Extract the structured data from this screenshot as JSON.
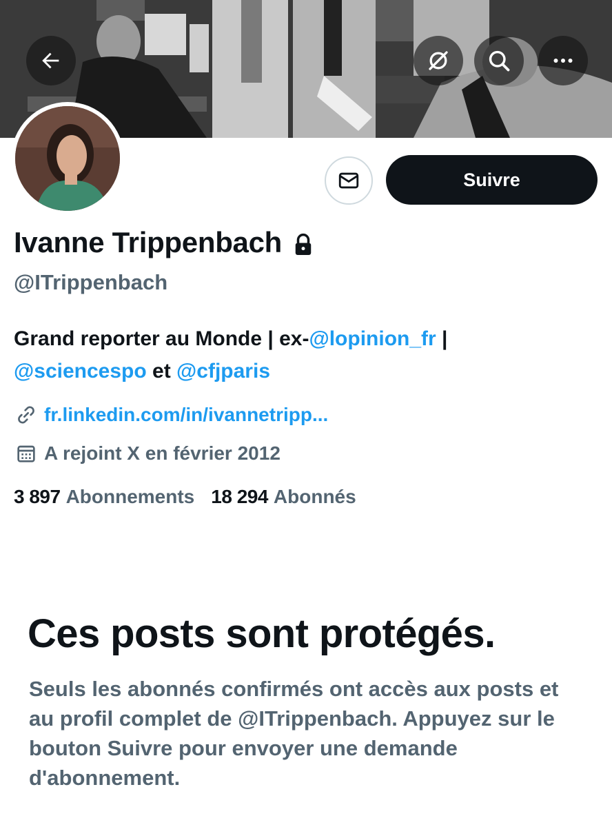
{
  "header": {
    "back_icon": "arrow-left-icon",
    "hide_icon": "eye-slash-icon",
    "search_icon": "search-icon",
    "more_icon": "more-horizontal-icon"
  },
  "profile": {
    "display_name": "Ivanne Trippenbach",
    "protected_icon": "lock-icon",
    "handle": "@ITrippenbach",
    "bio": {
      "part1": "Grand reporter au Monde | ex-",
      "mention1": "@lopinion_fr",
      "part2": " |",
      "mention2": "@sciencespo",
      "part3": " et ",
      "mention3": "@cfjparis"
    },
    "link": "fr.linkedin.com/in/ivannetripp...",
    "joined": "A rejoint X en février 2012",
    "following_count": "3 897",
    "following_label": "Abonnements",
    "followers_count": "18 294",
    "followers_label": "Abonnés"
  },
  "actions": {
    "message_icon": "mail-icon",
    "follow_label": "Suivre"
  },
  "protected": {
    "title": "Ces posts sont protégés.",
    "description": "Seuls les abonnés confirmés ont accès aux posts et au profil complet de @ITrippenbach. Appuyez sur le bouton Suivre pour envoyer une demande d'abonnement."
  },
  "colors": {
    "text_primary": "#0f1419",
    "text_secondary": "#536471",
    "link": "#1d9bf0",
    "button_bg": "#0f1419",
    "border": "#cfd9de"
  }
}
